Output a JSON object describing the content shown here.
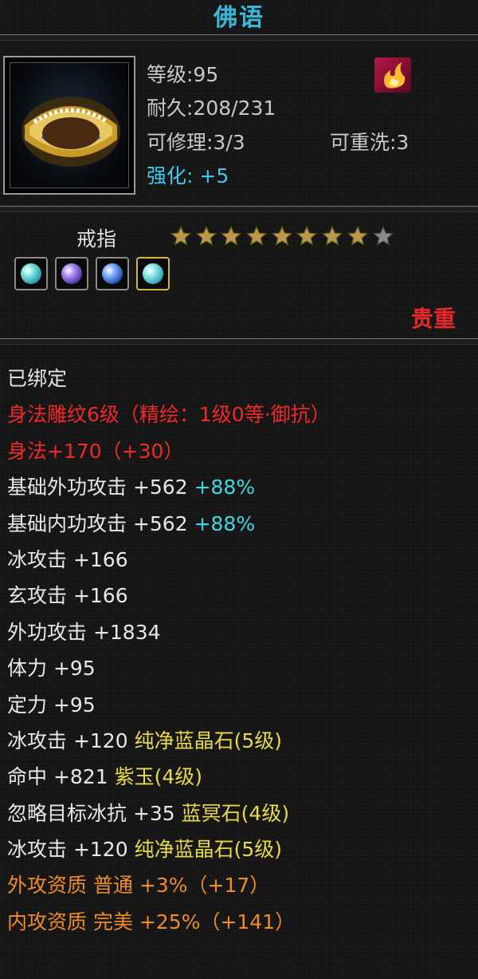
{
  "item": {
    "name": "佛语",
    "type": "戒指",
    "rarity": "贵重",
    "level": "等级:95",
    "durability": "耐久:208/231",
    "repairable": "可修理:3/3",
    "rewashable": "可重洗:3",
    "enhance": "强化: +5",
    "stars": {
      "filled": 8,
      "total": 9
    },
    "bound": "已绑定"
  },
  "gems": [
    {
      "name": "gem-1",
      "selected": false
    },
    {
      "name": "gem-2",
      "selected": false
    },
    {
      "name": "gem-3",
      "selected": false
    },
    {
      "name": "gem-4",
      "selected": true
    }
  ],
  "stats": {
    "engraving": "身法雕纹6级（精绘：1级0等·御抗）",
    "agility": "身法+170（+30）",
    "base_ext_attack": {
      "label": "基础外功攻击 +562",
      "bonus": "+88%"
    },
    "base_int_attack": {
      "label": "基础内功攻击 +562",
      "bonus": "+88%"
    },
    "ice_attack": "冰攻击 +166",
    "xuan_attack": "玄攻击 +166",
    "ext_attack": "外功攻击 +1834",
    "stamina": "体力 +95",
    "focus": "定力 +95",
    "gem_lines": [
      {
        "stat": "冰攻击 +120",
        "gem": "纯净蓝晶石(5级)"
      },
      {
        "stat": "命中 +821",
        "gem": "紫玉(4级)"
      },
      {
        "stat": "忽略目标冰抗 +35",
        "gem": "蓝冥石(4级)"
      },
      {
        "stat": "冰攻击 +120",
        "gem": "纯净蓝晶石(5级)"
      }
    ],
    "quality_ext": {
      "label": "外攻资质",
      "grade": "普通",
      "value": "+3%（+17）"
    },
    "quality_int": {
      "label": "内攻资质",
      "grade": "完美",
      "value": "+25%（+141）"
    }
  },
  "colors": {
    "title": "#38b8d8",
    "rarity": "#e8282a",
    "engraving": "#f02828",
    "bonus": "#40d8e0",
    "gem_name": "#e8d84c",
    "quality": "#f08c28"
  }
}
